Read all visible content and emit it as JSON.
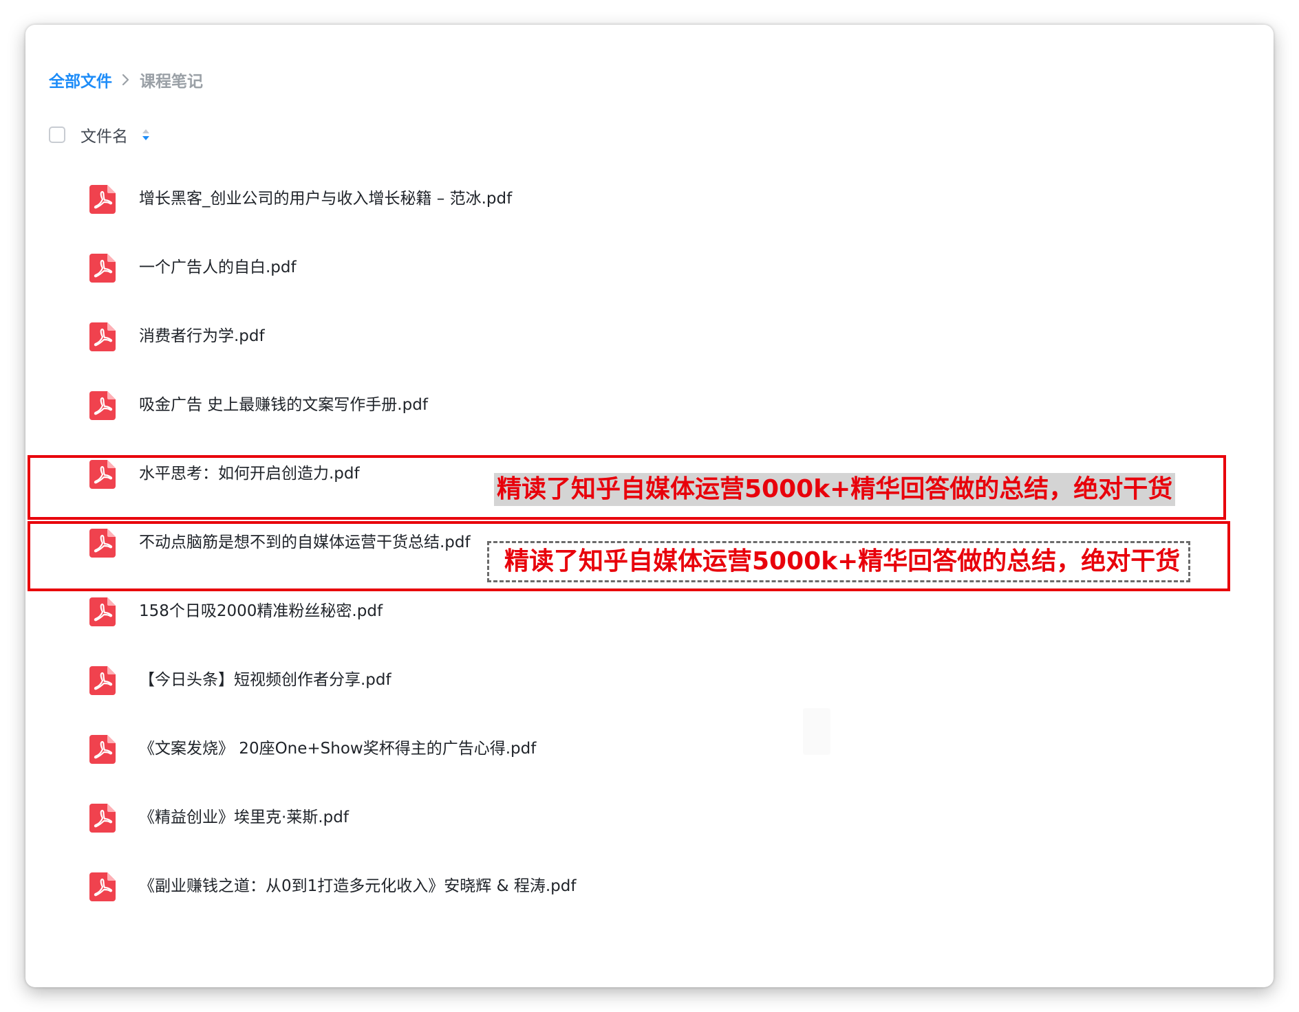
{
  "breadcrumb": {
    "root": "全部文件",
    "current": "课程笔记"
  },
  "list_header": {
    "column_title": "文件名"
  },
  "files": [
    {
      "name": "增长黑客_创业公司的用户与收入增长秘籍 – 范冰.pdf",
      "icon": "pdf-icon"
    },
    {
      "name": "一个广告人的自白.pdf",
      "icon": "pdf-icon"
    },
    {
      "name": "消费者行为学.pdf",
      "icon": "pdf-icon"
    },
    {
      "name": "吸金广告 史上最赚钱的文案写作手册.pdf",
      "icon": "pdf-icon"
    },
    {
      "name": "水平思考：如何开启创造力.pdf",
      "icon": "pdf-icon"
    },
    {
      "name": "不动点脑筋是想不到的自媒体运营干货总结.pdf",
      "icon": "pdf-icon"
    },
    {
      "name": "158个日吸2000精准粉丝秘密.pdf",
      "icon": "pdf-icon"
    },
    {
      "name": "【今日头条】短视频创作者分享.pdf",
      "icon": "pdf-icon"
    },
    {
      "name": "《文案发烧》 20座One+Show奖杯得主的广告心得.pdf",
      "icon": "pdf-icon"
    },
    {
      "name": "《精益创业》埃里克·莱斯.pdf",
      "icon": "pdf-icon"
    },
    {
      "name": "《副业赚钱之道：从0到1打造多元化收入》安晓辉 & 程涛.pdf",
      "icon": "pdf-icon"
    }
  ],
  "annotations": {
    "row6_note": "精读了知乎自媒体运营5000k+精华回答做的总结，绝对干货",
    "row7_note": "精读了知乎自媒体运营5000k+精华回答做的总结，绝对干货"
  },
  "colors": {
    "link_blue": "#1d8cf8",
    "pdf_red": "#f0424e",
    "highlight_red": "#e8000b"
  }
}
